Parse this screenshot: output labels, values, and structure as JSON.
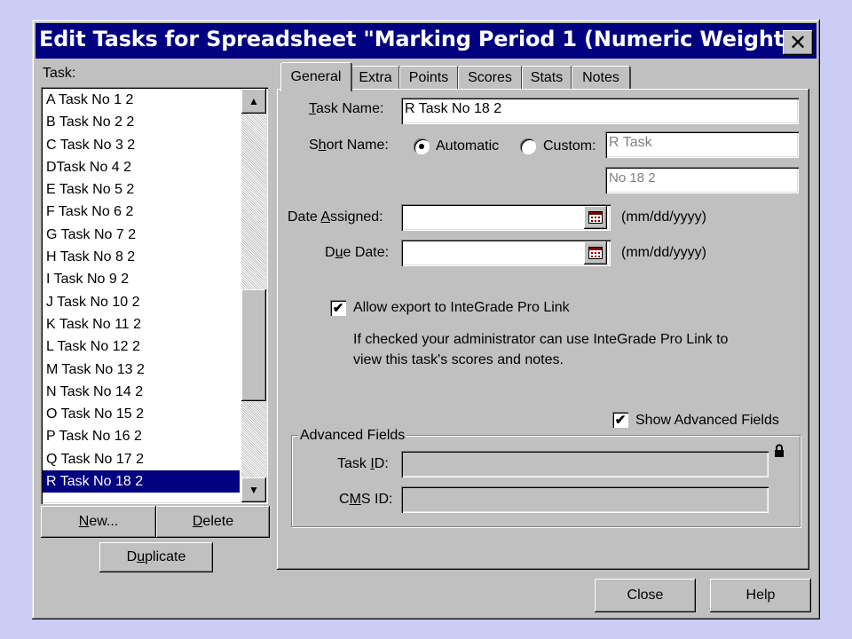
{
  "window": {
    "title": "Edit Tasks for Spreadsheet \"Marking Period 1 (Numeric Weight...",
    "close_glyph": "✕"
  },
  "task_list": {
    "label": "Task:",
    "items": [
      "A Task No 1 2",
      "B Task No 2 2",
      "C Task No 3 2",
      "DTask No 4 2",
      "E Task No 5 2",
      "F Task No 6 2",
      "G Task No 7 2",
      "H Task No 8 2",
      "I Task No 9 2",
      "J Task No 10 2",
      "K Task No 11 2",
      "L Task No 12 2",
      "M Task No 13 2",
      "N Task No 14 2",
      "O Task No 15 2",
      "P Task No 16 2",
      "Q Task No 17 2",
      "R Task No 18 2"
    ],
    "selected": "R Task No 18 2"
  },
  "list_buttons": {
    "new_pre": "",
    "new_key": "N",
    "new_post": "ew...",
    "delete_pre": "",
    "delete_key": "D",
    "delete_post": "elete",
    "duplicate_pre": "D",
    "duplicate_key": "u",
    "duplicate_post": "plicate"
  },
  "tabs": [
    "General",
    "Extra",
    "Points",
    "Scores",
    "Stats",
    "Notes"
  ],
  "active_tab": "General",
  "general": {
    "task_name_pre": "",
    "task_name_key": "T",
    "task_name_post": "ask Name:",
    "task_name_value": "R Task No 18 2",
    "short_name_pre": "S",
    "short_name_key": "h",
    "short_name_post": "ort Name:",
    "automatic_label": "Automatic",
    "custom_label": "Custom:",
    "short_name_selected": "Automatic",
    "short_name_line1": "R Task",
    "short_name_line2": "No 18 2",
    "date_assigned_pre": "Date ",
    "date_assigned_key": "A",
    "date_assigned_post": "ssigned:",
    "date_assigned_value": "",
    "due_date_pre": "D",
    "due_date_key": "u",
    "due_date_post": "e Date:",
    "due_date_value": "",
    "date_format_hint": "(mm/dd/yyyy)",
    "allow_export_label": "Allow export to InteGrade Pro Link",
    "allow_export_checked": true,
    "export_note_line1": "If checked your administrator can use InteGrade Pro Link to",
    "export_note_line2": "view this task's scores and notes.",
    "show_advanced_label": "Show Advanced Fields",
    "show_advanced_checked": true
  },
  "advanced": {
    "group_label": "Advanced Fields",
    "task_id_pre": "Task ",
    "task_id_key": "I",
    "task_id_post": "D:",
    "task_id_value": "",
    "cms_id_pre": "C",
    "cms_id_key": "M",
    "cms_id_post": "S ID:",
    "cms_id_value": ""
  },
  "footer": {
    "close_label": "Close",
    "help_label": "Help"
  }
}
